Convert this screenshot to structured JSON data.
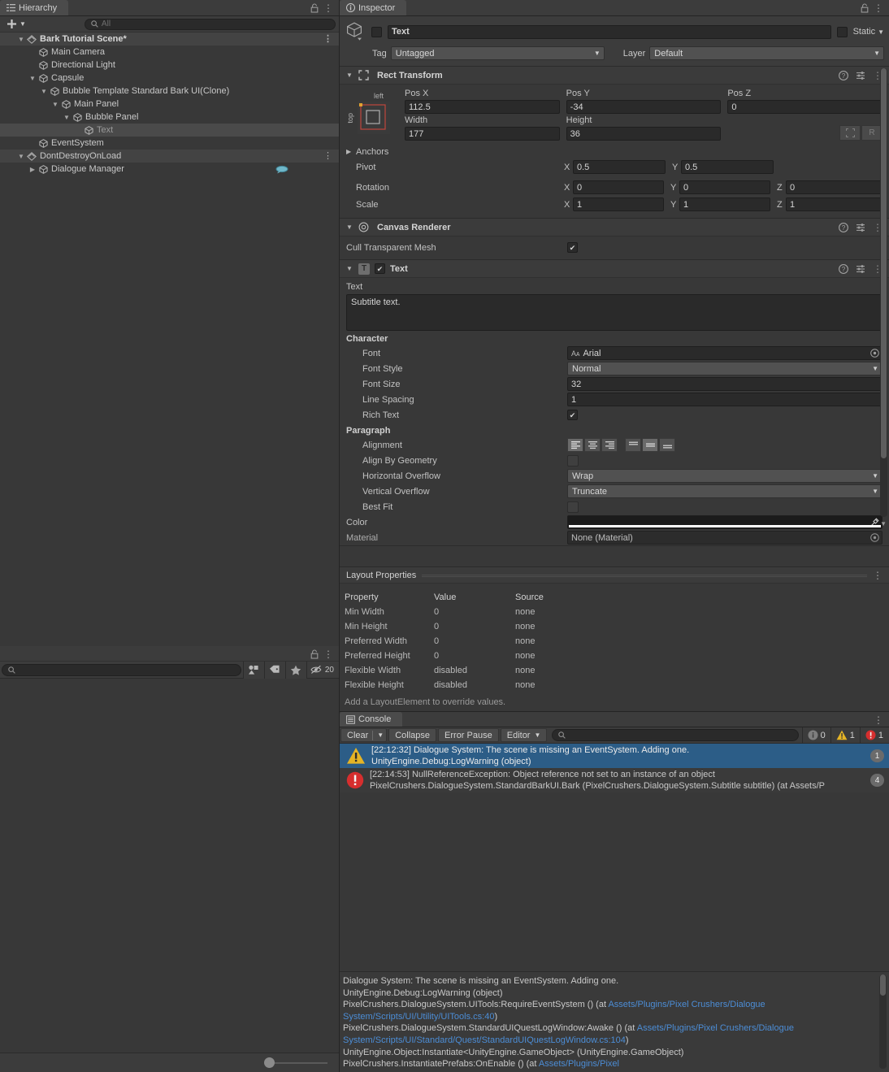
{
  "hierarchy": {
    "tab_label": "Hierarchy",
    "add_label": "+",
    "search_placeholder": "All",
    "rows": [
      {
        "label": "Bark Tutorial Scene*",
        "depth": 1,
        "icon": "scene-icon",
        "arrow": "open",
        "state": "scene",
        "kebab": true
      },
      {
        "label": "Main Camera",
        "depth": 2,
        "icon": "gameobject-icon",
        "arrow": "none",
        "state": "normal"
      },
      {
        "label": "Directional Light",
        "depth": 2,
        "icon": "gameobject-icon",
        "arrow": "none",
        "state": "normal"
      },
      {
        "label": "Capsule",
        "depth": 2,
        "icon": "gameobject-icon",
        "arrow": "open",
        "state": "normal"
      },
      {
        "label": "Bubble Template Standard Bark UI(Clone)",
        "depth": 3,
        "icon": "gameobject-icon",
        "arrow": "open",
        "state": "normal"
      },
      {
        "label": "Main Panel",
        "depth": 4,
        "icon": "gameobject-icon",
        "arrow": "open",
        "state": "normal"
      },
      {
        "label": "Bubble Panel",
        "depth": 5,
        "icon": "gameobject-icon",
        "arrow": "open",
        "state": "normal"
      },
      {
        "label": "Text",
        "depth": 6,
        "icon": "gameobject-icon",
        "arrow": "none",
        "state": "selected"
      },
      {
        "label": "EventSystem",
        "depth": 2,
        "icon": "gameobject-icon",
        "arrow": "none",
        "state": "normal"
      },
      {
        "label": "DontDestroyOnLoad",
        "depth": 1,
        "icon": "scene-icon",
        "arrow": "open",
        "state": "ddol",
        "kebab": true
      },
      {
        "label": "Dialogue Manager",
        "depth": 2,
        "icon": "gameobject-icon",
        "arrow": "closed",
        "state": "normal",
        "bubble": true
      }
    ]
  },
  "project": {
    "search_placeholder": "",
    "visibility_count": "20",
    "icons": [
      "asset-filter-icon",
      "label-filter-icon",
      "favorite-star-icon",
      "hidden-eye-icon"
    ]
  },
  "inspector": {
    "tab_label": "Inspector",
    "object_name": "Text",
    "static_label": "Static",
    "tag_label": "Tag",
    "tag_value": "Untagged",
    "layer_label": "Layer",
    "layer_value": "Default",
    "rect_transform": {
      "title": "Rect Transform",
      "anchor_top_label": "left",
      "anchor_side_label": "top",
      "pos_x_label": "Pos X",
      "pos_x": "112.5",
      "pos_y_label": "Pos Y",
      "pos_y": "-34",
      "pos_z_label": "Pos Z",
      "pos_z": "0",
      "width_label": "Width",
      "width": "177",
      "height_label": "Height",
      "height": "36",
      "blueprint_label": "",
      "raw_label": "R",
      "anchors_label": "Anchors",
      "pivot_label": "Pivot",
      "pivot_x": "0.5",
      "pivot_y": "0.5",
      "rotation_label": "Rotation",
      "rot_x": "0",
      "rot_y": "0",
      "rot_z": "0",
      "scale_label": "Scale",
      "scale_x": "1",
      "scale_y": "1",
      "scale_z": "1",
      "axis_x": "X",
      "axis_y": "Y",
      "axis_z": "Z"
    },
    "canvas_renderer": {
      "title": "Canvas Renderer",
      "cull_label": "Cull Transparent Mesh"
    },
    "text_component": {
      "title": "Text",
      "text_label": "Text",
      "text_value": "Subtitle text.",
      "character_label": "Character",
      "font_label": "Font",
      "font_value": "Arial",
      "font_style_label": "Font Style",
      "font_style_value": "Normal",
      "font_size_label": "Font Size",
      "font_size_value": "32",
      "line_spacing_label": "Line Spacing",
      "line_spacing_value": "1",
      "rich_text_label": "Rich Text",
      "paragraph_label": "Paragraph",
      "alignment_label": "Alignment",
      "align_h_active": 0,
      "align_v_active": 1,
      "align_by_geometry_label": "Align By Geometry",
      "horizontal_overflow_label": "Horizontal Overflow",
      "horizontal_overflow_value": "Wrap",
      "vertical_overflow_label": "Vertical Overflow",
      "vertical_overflow_value": "Truncate",
      "best_fit_label": "Best Fit",
      "color_label": "Color",
      "material_label": "Material",
      "material_value": "None (Material)"
    }
  },
  "layout_properties": {
    "title": "Layout Properties",
    "columns": [
      "Property",
      "Value",
      "Source"
    ],
    "rows": [
      [
        "Min Width",
        "0",
        "none"
      ],
      [
        "Min Height",
        "0",
        "none"
      ],
      [
        "Preferred Width",
        "0",
        "none"
      ],
      [
        "Preferred Height",
        "0",
        "none"
      ],
      [
        "Flexible Width",
        "disabled",
        "none"
      ],
      [
        "Flexible Height",
        "disabled",
        "none"
      ]
    ],
    "note": "Add a LayoutElement to override values."
  },
  "console": {
    "tab_label": "Console",
    "clear_label": "Clear",
    "collapse_label": "Collapse",
    "error_pause_label": "Error Pause",
    "editor_label": "Editor",
    "search_placeholder": "",
    "log_count": "0",
    "warn_count": "1",
    "err_count": "1",
    "entries": [
      {
        "type": "warning",
        "line1": "[22:12:32] Dialogue System: The scene is missing an EventSystem. Adding one.",
        "line2": "UnityEngine.Debug:LogWarning (object)",
        "count": "1",
        "selected": true
      },
      {
        "type": "error",
        "line1": "[22:14:53] NullReferenceException: Object reference not set to an instance of an object",
        "line2": "PixelCrushers.DialogueSystem.StandardBarkUI.Bark (PixelCrushers.DialogueSystem.Subtitle subtitle) (at Assets/P",
        "count": "4",
        "selected": false
      }
    ],
    "detail_lines": [
      [
        {
          "t": "Dialogue System: The scene is missing an EventSystem. Adding one.",
          "link": false
        }
      ],
      [
        {
          "t": "UnityEngine.Debug:LogWarning (object)",
          "link": false
        }
      ],
      [
        {
          "t": "PixelCrushers.DialogueSystem.UITools:RequireEventSystem () (at ",
          "link": false
        },
        {
          "t": "Assets/Plugins/Pixel Crushers/Dialogue System/Scripts/UI/Utility/UITools.cs:40",
          "link": true
        },
        {
          "t": ")",
          "link": false
        }
      ],
      [
        {
          "t": "PixelCrushers.DialogueSystem.StandardUIQuestLogWindow:Awake () (at ",
          "link": false
        },
        {
          "t": "Assets/Plugins/Pixel Crushers/Dialogue System/Scripts/UI/Standard/Quest/StandardUIQuestLogWindow.cs:104",
          "link": true
        },
        {
          "t": ")",
          "link": false
        }
      ],
      [
        {
          "t": "UnityEngine.Object:Instantiate<UnityEngine.GameObject> (UnityEngine.GameObject)",
          "link": false
        }
      ],
      [
        {
          "t": "PixelCrushers.InstantiatePrefabs:OnEnable () (at ",
          "link": false
        },
        {
          "t": "Assets/Plugins/Pixel",
          "link": true
        }
      ]
    ]
  },
  "colors": {
    "panel_bg": "#383838",
    "header_bg": "#3c3c3c",
    "selection_blue": "#2c5d87",
    "warn_yellow": "#e5b425",
    "err_red": "#d62e2e",
    "link_blue": "#4c8dd6",
    "anchor_red": "#c0463c",
    "pivot_orange": "#e0a030"
  }
}
